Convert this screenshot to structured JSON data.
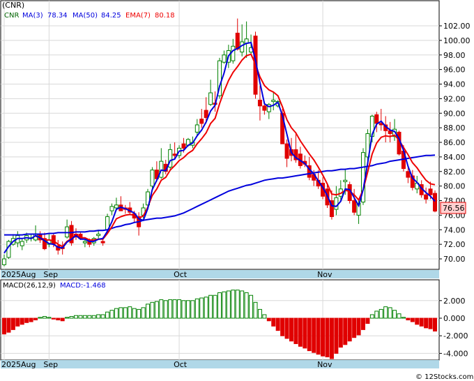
{
  "title": "(CNR)",
  "legend": {
    "symbol": "CNR",
    "ma3_label": "MA(3)",
    "ma3_value": "78.34",
    "ma50_label": "MA(50)",
    "ma50_value": "84.25",
    "ema7_label": "EMA(7)",
    "ema7_value": "80.18"
  },
  "last_price_label": "76.56",
  "macd_legend": {
    "label": "MACD(26,12,9)",
    "value_label": "MACD:-1.468"
  },
  "watermark": "© 12Stocks.com",
  "colors": {
    "up": "#008000",
    "down": "#e00000",
    "ma3": "#0000dd",
    "ma50": "#0000dd",
    "ema7": "#ee0000",
    "axis_band": "#b0d8e8",
    "grid": "#d8d8d8"
  },
  "chart_data": [
    {
      "type": "candlestick",
      "title": "(CNR)",
      "y_ticks": [
        "70.00",
        "72.00",
        "74.00",
        "76.00",
        "78.00",
        "80.00",
        "82.00",
        "84.00",
        "86.00",
        "88.00",
        "90.00",
        "92.00",
        "94.00",
        "96.00",
        "98.00",
        "100.00",
        "102.00"
      ],
      "x_tick_labels": [
        {
          "label": "2025Aug",
          "index": 0
        },
        {
          "label": "Sep",
          "index": 10
        },
        {
          "label": "Oct",
          "index": 39
        },
        {
          "label": "Nov",
          "index": 71
        }
      ],
      "candles": [
        [
          69.2,
          70.6,
          69.0,
          70.0
        ],
        [
          70.2,
          72.6,
          70.0,
          72.4
        ],
        [
          72.0,
          73.4,
          71.8,
          72.8
        ],
        [
          72.2,
          73.8,
          71.6,
          73.2
        ],
        [
          71.8,
          72.8,
          71.2,
          72.4
        ],
        [
          72.6,
          73.6,
          72.2,
          73.2
        ],
        [
          72.8,
          73.4,
          72.4,
          72.9
        ],
        [
          72.6,
          74.6,
          72.4,
          73.4
        ],
        [
          73.4,
          73.8,
          72.2,
          72.6
        ],
        [
          72.8,
          73.6,
          71.2,
          71.4
        ],
        [
          72.0,
          73.4,
          71.6,
          72.6
        ],
        [
          73.2,
          73.6,
          71.6,
          72.0
        ],
        [
          71.8,
          72.6,
          70.6,
          71.2
        ],
        [
          71.6,
          72.4,
          70.6,
          71.4
        ],
        [
          73.0,
          75.4,
          72.8,
          74.4
        ],
        [
          74.6,
          75.2,
          71.8,
          72.2
        ],
        [
          73.4,
          74.2,
          72.6,
          73.0
        ],
        [
          73.4,
          73.6,
          72.6,
          72.8
        ],
        [
          72.2,
          72.8,
          71.6,
          72.4
        ],
        [
          72.4,
          72.8,
          71.6,
          72.0
        ],
        [
          72.2,
          73.0,
          71.8,
          72.8
        ],
        [
          73.2,
          74.0,
          72.8,
          73.4
        ],
        [
          72.4,
          73.0,
          71.8,
          72.2
        ],
        [
          74.0,
          76.2,
          73.6,
          75.8
        ],
        [
          76.6,
          77.6,
          76.0,
          77.2
        ],
        [
          77.0,
          78.4,
          76.6,
          77.4
        ],
        [
          77.4,
          78.6,
          76.6,
          76.6
        ],
        [
          77.0,
          77.4,
          76.2,
          76.8
        ],
        [
          77.0,
          77.8,
          76.2,
          76.4
        ],
        [
          76.2,
          76.6,
          75.0,
          75.6
        ],
        [
          75.8,
          76.4,
          73.2,
          74.4
        ],
        [
          76.0,
          77.6,
          75.6,
          77.0
        ],
        [
          77.4,
          79.6,
          76.8,
          79.2
        ],
        [
          80.0,
          82.6,
          79.6,
          82.2
        ],
        [
          82.2,
          83.4,
          80.6,
          81.0
        ],
        [
          81.2,
          85.2,
          81.0,
          83.4
        ],
        [
          83.0,
          83.6,
          81.6,
          82.0
        ],
        [
          82.6,
          85.8,
          82.2,
          85.0
        ],
        [
          84.4,
          86.0,
          83.8,
          84.2
        ],
        [
          84.2,
          85.6,
          83.8,
          85.2
        ],
        [
          85.8,
          86.6,
          84.6,
          85.2
        ],
        [
          85.6,
          86.6,
          85.4,
          86.4
        ],
        [
          85.6,
          86.8,
          85.2,
          86.0
        ],
        [
          87.4,
          89.2,
          87.0,
          88.4
        ],
        [
          89.2,
          90.6,
          88.0,
          88.6
        ],
        [
          90.4,
          92.2,
          88.6,
          89.4
        ],
        [
          91.2,
          94.6,
          91.0,
          92.8
        ],
        [
          91.4,
          93.0,
          90.2,
          91.2
        ],
        [
          92.4,
          97.6,
          92.0,
          97.2
        ],
        [
          97.0,
          98.6,
          96.8,
          98.0
        ],
        [
          97.0,
          99.4,
          96.2,
          98.6
        ],
        [
          97.2,
          100.2,
          96.8,
          99.2
        ],
        [
          101.0,
          103.0,
          98.6,
          98.8
        ],
        [
          98.4,
          102.2,
          97.8,
          99.8
        ],
        [
          99.6,
          102.6,
          97.6,
          100.2
        ],
        [
          98.4,
          100.8,
          98.0,
          99.0
        ],
        [
          100.6,
          101.2,
          92.0,
          92.6
        ],
        [
          91.8,
          93.8,
          89.0,
          91.0
        ],
        [
          91.0,
          91.6,
          89.8,
          90.4
        ],
        [
          90.2,
          91.4,
          89.2,
          91.2
        ],
        [
          91.6,
          93.0,
          90.4,
          91.8
        ],
        [
          91.0,
          91.8,
          90.8,
          91.6
        ],
        [
          90.0,
          90.6,
          87.8,
          85.8
        ],
        [
          85.8,
          86.4,
          82.6,
          83.8
        ],
        [
          85.0,
          86.6,
          83.4,
          84.2
        ],
        [
          85.0,
          87.4,
          83.2,
          83.6
        ],
        [
          84.4,
          85.4,
          82.4,
          82.8
        ],
        [
          83.4,
          84.2,
          82.6,
          83.0
        ],
        [
          82.8,
          84.0,
          80.8,
          81.2
        ],
        [
          81.6,
          82.2,
          80.0,
          80.8
        ],
        [
          80.8,
          82.2,
          79.6,
          80.0
        ],
        [
          80.4,
          81.2,
          78.2,
          78.6
        ],
        [
          79.6,
          80.4,
          77.0,
          77.4
        ],
        [
          78.0,
          79.4,
          75.4,
          75.8
        ],
        [
          76.8,
          80.0,
          76.0,
          78.4
        ],
        [
          78.6,
          80.8,
          77.8,
          79.6
        ],
        [
          80.6,
          82.4,
          78.8,
          80.8
        ],
        [
          80.2,
          80.6,
          77.6,
          78.0
        ],
        [
          78.0,
          79.6,
          76.0,
          76.4
        ],
        [
          76.0,
          78.0,
          74.8,
          77.6
        ],
        [
          77.8,
          85.2,
          77.4,
          84.6
        ],
        [
          84.0,
          87.8,
          82.6,
          87.2
        ],
        [
          86.8,
          89.8,
          86.0,
          89.6
        ],
        [
          89.8,
          90.2,
          87.4,
          88.6
        ],
        [
          88.6,
          90.6,
          87.6,
          88.4
        ],
        [
          88.4,
          89.6,
          86.0,
          87.6
        ],
        [
          87.6,
          88.8,
          86.0,
          87.2
        ],
        [
          86.8,
          89.2,
          86.2,
          87.8
        ],
        [
          87.4,
          87.6,
          84.2,
          84.4
        ],
        [
          84.8,
          85.6,
          82.0,
          82.4
        ],
        [
          82.0,
          82.6,
          80.4,
          81.2
        ],
        [
          81.4,
          82.2,
          79.4,
          79.8
        ],
        [
          79.6,
          81.4,
          79.0,
          80.4
        ],
        [
          80.2,
          80.8,
          78.4,
          78.8
        ],
        [
          78.8,
          79.8,
          77.6,
          78.2
        ],
        [
          79.6,
          80.6,
          78.2,
          78.8
        ],
        [
          79.0,
          79.4,
          76.4,
          76.56
        ]
      ],
      "ma3": [
        70.8,
        71.7,
        72.4,
        72.8,
        72.8,
        72.9,
        72.8,
        73.2,
        72.9,
        72.5,
        72.1,
        72.0,
        71.6,
        71.5,
        72.3,
        72.7,
        73.2,
        72.7,
        72.7,
        72.4,
        72.4,
        72.7,
        72.8,
        73.8,
        75.1,
        76.8,
        77.1,
        76.9,
        76.6,
        76.3,
        75.5,
        75.3,
        76.9,
        79.5,
        80.8,
        82.2,
        82.1,
        83.5,
        83.7,
        84.8,
        84.9,
        85.6,
        85.9,
        86.9,
        87.7,
        88.8,
        90.3,
        91.1,
        93.7,
        95.5,
        97.9,
        98.6,
        98.9,
        99.3,
        99.6,
        99.7,
        97.3,
        94.2,
        91.3,
        90.9,
        91.1,
        91.5,
        89.7,
        87.1,
        84.6,
        83.9,
        83.5,
        83.1,
        82.3,
        81.7,
        80.7,
        79.8,
        78.7,
        77.3,
        77.2,
        77.9,
        79.6,
        79.5,
        78.4,
        77.3,
        79.5,
        83.1,
        87.1,
        88.5,
        88.9,
        88.2,
        87.7,
        87.5,
        86.5,
        84.9,
        82.7,
        81.1,
        80.5,
        79.7,
        79.1,
        78.6,
        77.9
      ],
      "ma50": [
        73.3,
        73.3,
        73.3,
        73.3,
        73.3,
        73.4,
        73.4,
        73.4,
        73.4,
        73.4,
        73.5,
        73.5,
        73.6,
        73.6,
        73.6,
        73.6,
        73.7,
        73.7,
        73.7,
        73.8,
        73.8,
        73.9,
        73.9,
        74.0,
        74.2,
        74.4,
        74.5,
        74.7,
        74.8,
        75.0,
        75.1,
        75.3,
        75.4,
        75.5,
        75.6,
        75.6,
        75.7,
        75.8,
        75.9,
        76.1,
        76.3,
        76.6,
        76.9,
        77.2,
        77.5,
        77.8,
        78.1,
        78.4,
        78.7,
        79.0,
        79.3,
        79.5,
        79.7,
        79.9,
        80.1,
        80.2,
        80.4,
        80.6,
        80.8,
        80.9,
        81.0,
        81.1,
        81.1,
        81.2,
        81.3,
        81.4,
        81.5,
        81.6,
        81.7,
        81.8,
        81.9,
        82.0,
        82.1,
        82.1,
        82.2,
        82.3,
        82.3,
        82.4,
        82.4,
        82.5,
        82.6,
        82.7,
        82.8,
        83.0,
        83.1,
        83.2,
        83.4,
        83.5,
        83.6,
        83.7,
        83.8,
        83.9,
        84.0,
        84.1,
        84.2,
        84.2,
        84.25
      ],
      "ema7": [
        null,
        null,
        null,
        null,
        null,
        null,
        null,
        73.1,
        73.0,
        72.6,
        72.6,
        72.5,
        72.0,
        71.7,
        72.4,
        72.8,
        73.3,
        72.9,
        72.9,
        72.6,
        72.6,
        72.7,
        72.7,
        73.5,
        74.4,
        75.5,
        75.8,
        76.0,
        76.1,
        76.0,
        75.6,
        75.9,
        77.1,
        78.7,
        79.6,
        80.8,
        81.2,
        82.2,
        82.8,
        83.5,
        83.9,
        84.5,
        84.9,
        85.8,
        86.5,
        87.3,
        88.6,
        89.3,
        91.3,
        93.0,
        94.5,
        95.6,
        96.4,
        97.3,
        97.9,
        98.1,
        96.7,
        95.0,
        93.8,
        93.2,
        92.9,
        92.4,
        90.9,
        89.1,
        88.0,
        87.3,
        86.2,
        85.3,
        84.4,
        83.6,
        82.6,
        81.5,
        80.3,
        78.9,
        78.8,
        79.0,
        79.4,
        79.3,
        78.8,
        78.1,
        79.5,
        81.9,
        84.4,
        85.9,
        86.7,
        86.9,
        86.8,
        87.0,
        86.3,
        85.3,
        84.3,
        83.2,
        82.5,
        81.6,
        80.8,
        80.3,
        80.18
      ]
    },
    {
      "type": "bar",
      "title": "MACD(26,12,9)",
      "y_ticks": [
        "-4.000",
        "-2.000",
        "0.000",
        "2.000"
      ],
      "values": [
        -1.8,
        -1.6,
        -1.3,
        -0.9,
        -0.7,
        -0.5,
        -0.4,
        -0.2,
        0.1,
        0.2,
        0.1,
        -0.1,
        -0.2,
        -0.3,
        0.1,
        0.2,
        0.3,
        0.3,
        0.3,
        0.3,
        0.3,
        0.4,
        0.4,
        0.7,
        0.9,
        1.1,
        1.2,
        1.2,
        1.3,
        1.1,
        1.0,
        1.2,
        1.6,
        1.8,
        1.9,
        2.1,
        2.0,
        2.1,
        2.1,
        2.1,
        2.0,
        2.0,
        2.0,
        2.2,
        2.3,
        2.4,
        2.6,
        2.6,
        2.9,
        3.0,
        3.1,
        3.2,
        3.2,
        3.1,
        2.9,
        2.6,
        1.8,
        1.0,
        0.4,
        -0.3,
        -0.9,
        -1.4,
        -2.0,
        -2.3,
        -2.6,
        -2.9,
        -3.2,
        -3.4,
        -3.7,
        -3.9,
        -4.1,
        -4.3,
        -4.4,
        -4.6,
        -4.0,
        -3.3,
        -3.0,
        -2.6,
        -2.2,
        -1.9,
        -1.3,
        -0.6,
        0.4,
        0.8,
        1.0,
        1.3,
        1.2,
        0.9,
        0.5,
        0.1,
        -0.2,
        -0.4,
        -0.7,
        -0.9,
        -1.1,
        -1.2,
        -1.468
      ],
      "x_tick_labels": [
        {
          "label": "2025Aug",
          "index": 0
        },
        {
          "label": "Sep",
          "index": 10
        },
        {
          "label": "Oct",
          "index": 39
        },
        {
          "label": "Nov",
          "index": 71
        }
      ]
    }
  ]
}
